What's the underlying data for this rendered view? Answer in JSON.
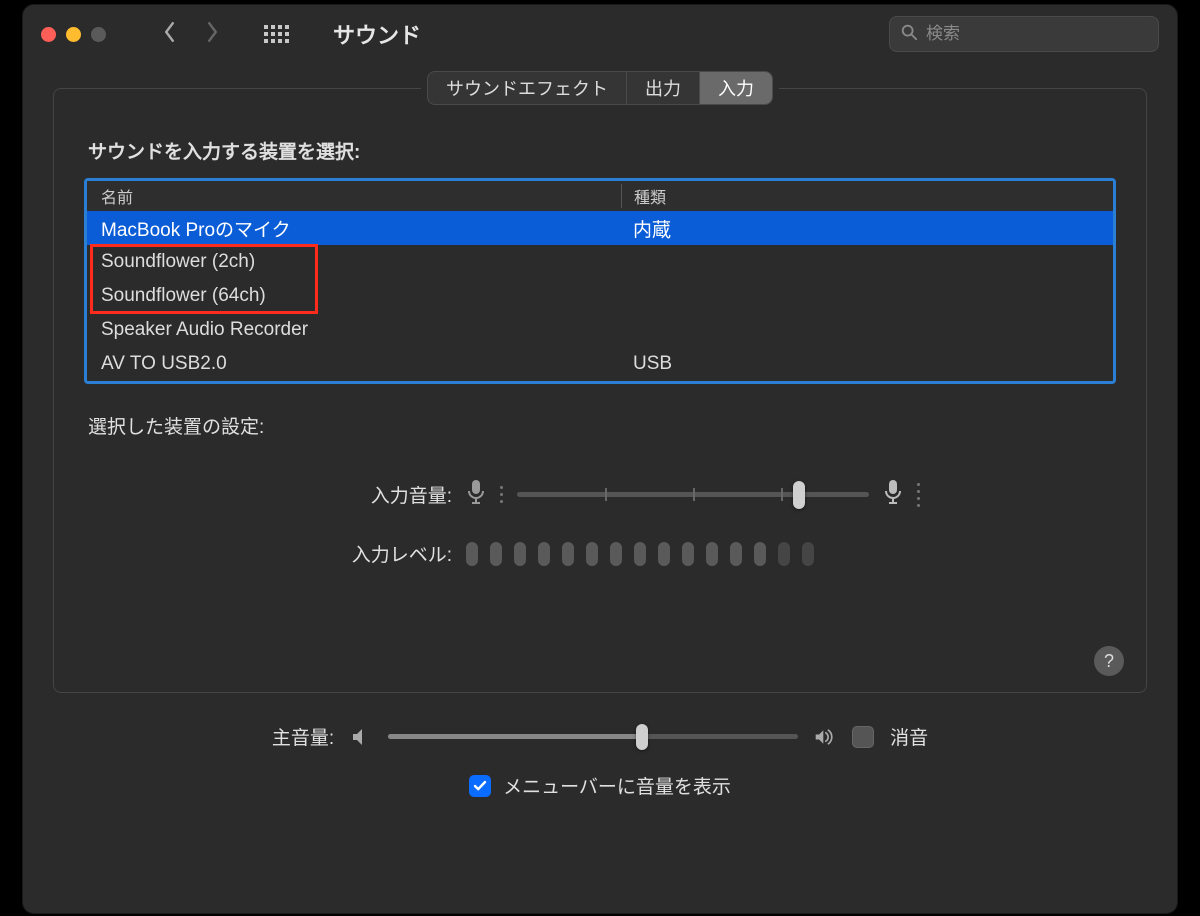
{
  "window": {
    "title": "サウンド"
  },
  "search": {
    "placeholder": "検索"
  },
  "tabs": [
    {
      "label": "サウンドエフェクト",
      "active": false
    },
    {
      "label": "出力",
      "active": false
    },
    {
      "label": "入力",
      "active": true
    }
  ],
  "section_label": "サウンドを入力する装置を選択:",
  "columns": {
    "name": "名前",
    "type": "種類"
  },
  "devices": [
    {
      "name": "MacBook Proのマイク",
      "type": "内蔵",
      "selected": true
    },
    {
      "name": "Soundflower (2ch)",
      "type": "",
      "selected": false
    },
    {
      "name": "Soundflower (64ch)",
      "type": "",
      "selected": false
    },
    {
      "name": "Speaker Audio Recorder",
      "type": "",
      "selected": false
    },
    {
      "name": "AV TO USB2.0",
      "type": "USB",
      "selected": false
    }
  ],
  "highlight_rows": [
    1,
    2
  ],
  "settings_label": "選択した装置の設定:",
  "input_volume": {
    "label": "入力音量:",
    "value_pct": 80
  },
  "input_level": {
    "label": "入力レベル:",
    "bars": 15,
    "fade_from": 13
  },
  "main_volume": {
    "label": "主音量:",
    "value_pct": 62,
    "mute_label": "消音",
    "muted": false
  },
  "menubar": {
    "label": "メニューバーに音量を表示",
    "checked": true
  },
  "help_glyph": "?"
}
